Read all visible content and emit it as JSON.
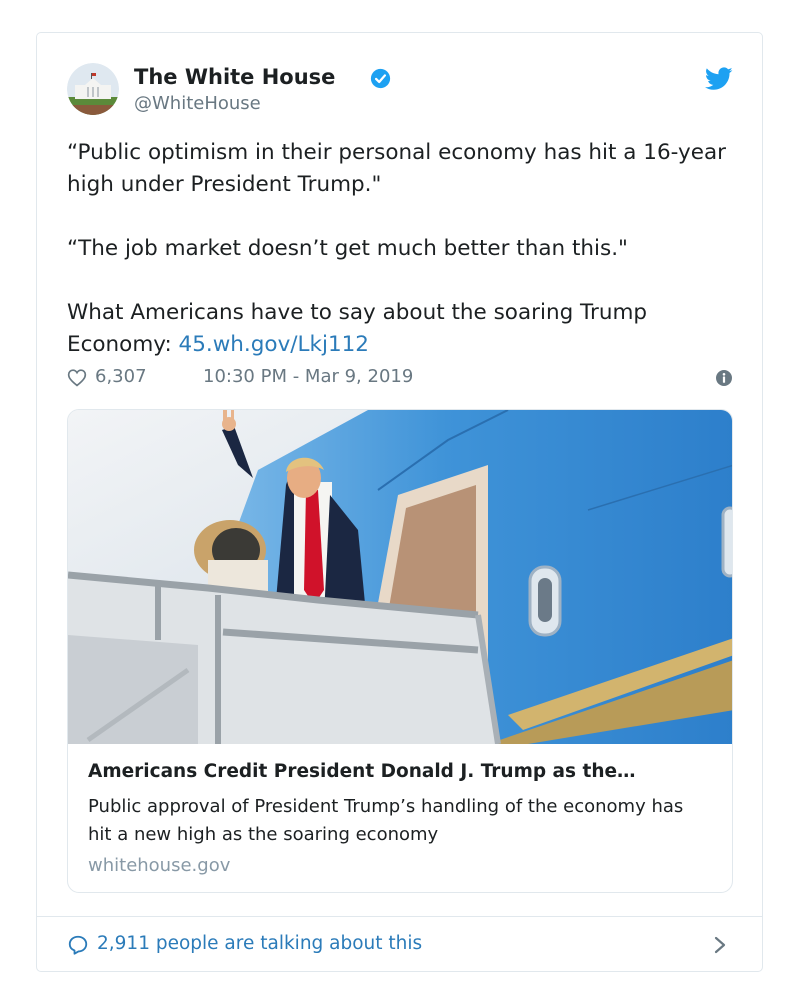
{
  "tweet": {
    "author_name": "The White House",
    "author_handle": "@WhiteHouse",
    "paragraph_1": "“Public optimism in their personal economy has hit a 16-year high under President Trump.\"",
    "paragraph_2": "“The job market doesn’t get much better than this.\"",
    "paragraph_3_text": "What Americans have to say about the soaring Trump Economy: ",
    "paragraph_3_link": "45.wh.gov/Lkj112",
    "likes": "6,307",
    "timestamp": "10:30 PM - Mar 9, 2019"
  },
  "link_card": {
    "title": "Americans Credit President Donald J. Trump as the…",
    "description": "Public approval of President Trump’s handling of the economy has hit a new high as the soaring economy",
    "domain": "whitehouse.gov"
  },
  "footer": {
    "talking": "2,911 people are talking about this"
  },
  "icons": {
    "verified": "verified-badge-icon",
    "bird": "twitter-bird-icon",
    "heart": "heart-icon",
    "info": "info-icon",
    "bubble": "speech-bubble-icon",
    "chevron": "chevron-right-icon"
  },
  "colors": {
    "link": "#2b7bb9",
    "twitter_blue": "#1da1f2",
    "muted": "#697882"
  }
}
